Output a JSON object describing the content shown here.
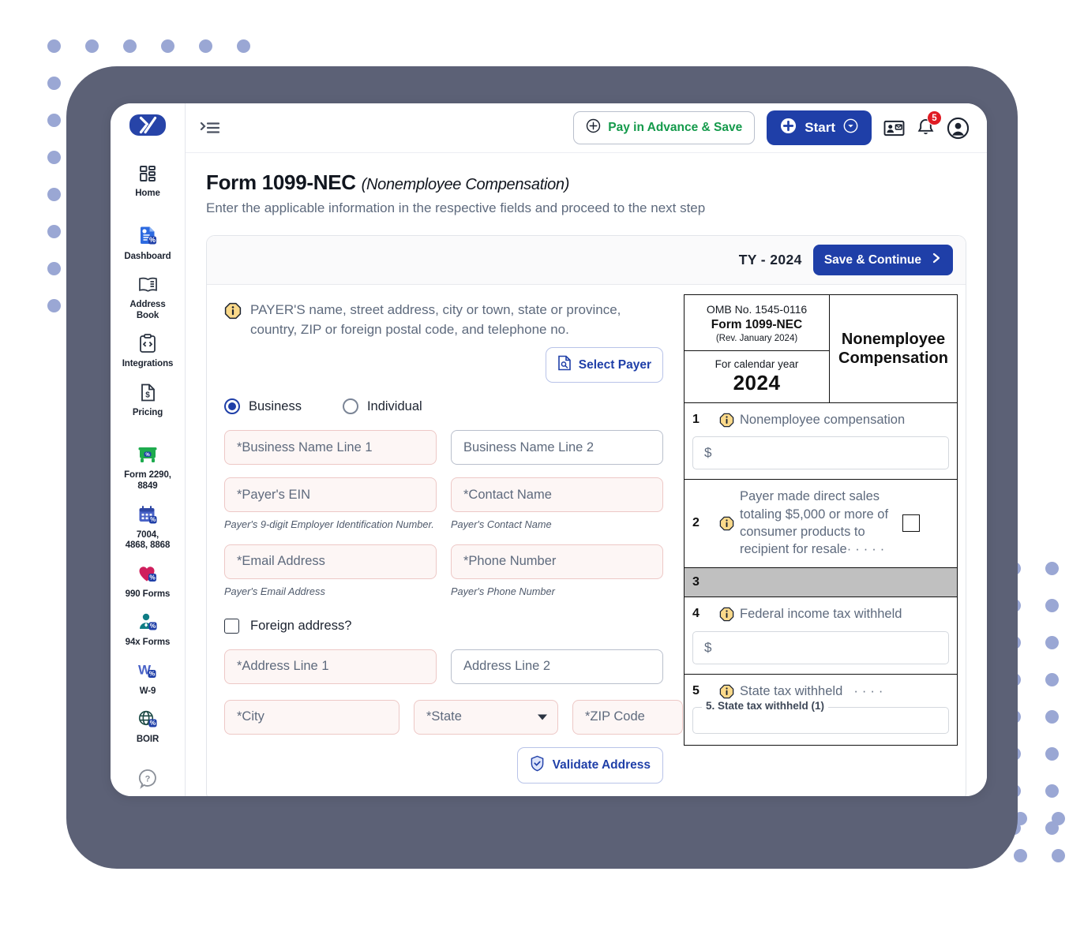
{
  "brand": {
    "logo_letter": "X",
    "accent": "#1f3fa8",
    "slab_color": "#5c6176",
    "dot_color": "#9aa7d4"
  },
  "sidebar": {
    "items": [
      {
        "label": "Home",
        "icon": "grid-icon"
      },
      {
        "label": "Dashboard",
        "icon": "dashboard-doc-icon"
      },
      {
        "label": "Address\nBook",
        "icon": "address-book-icon"
      },
      {
        "label": "Integrations",
        "icon": "integrations-code-icon"
      },
      {
        "label": "Pricing",
        "icon": "pricing-dollar-icon"
      },
      {
        "label": "Form 2290,\n8849",
        "icon": "truck-icon"
      },
      {
        "label": "7004,\n4868, 8868",
        "icon": "calendar-icon"
      },
      {
        "label": "990 Forms",
        "icon": "heart-icon"
      },
      {
        "label": "94x Forms",
        "icon": "person-tie-icon"
      },
      {
        "label": "W-9",
        "icon": "w9-icon"
      },
      {
        "label": "BOIR",
        "icon": "globe-icon"
      }
    ],
    "help_icon": "help-question-icon"
  },
  "topbar": {
    "menu_icon": "menu-collapse-icon",
    "pay_in_advance_label": "Pay in Advance & Save",
    "start_label": "Start",
    "contact_card_icon": "contact-card-icon",
    "bell_icon": "notification-bell-icon",
    "notification_count": "5",
    "avatar_icon": "user-avatar-icon"
  },
  "page": {
    "title": "Form 1099-NEC",
    "title_sub": "(Nonemployee Compensation)",
    "description": "Enter the applicable information in the respective fields and proceed to the next step"
  },
  "card_header": {
    "tax_year": "TY - 2024",
    "save_continue_label": "Save & Continue"
  },
  "payer": {
    "note_line1": "PAYER'S name, street address, city or town, state or province,",
    "note_line2": "country, ZIP or foreign postal code, and telephone no.",
    "select_payer_label": "Select Payer",
    "entity_options": [
      {
        "label": "Business",
        "selected": true
      },
      {
        "label": "Individual",
        "selected": false
      }
    ],
    "fields": {
      "business_name_1": {
        "placeholder": "*Business Name Line 1",
        "value": "",
        "required": true
      },
      "business_name_2": {
        "placeholder": "Business Name Line 2",
        "value": "",
        "required": false
      },
      "ein": {
        "placeholder": "*Payer's EIN",
        "value": "",
        "required": true,
        "hint": "Payer's 9-digit Employer Identification Number."
      },
      "contact_name": {
        "placeholder": "*Contact Name",
        "value": "",
        "required": true,
        "hint": "Payer's Contact Name"
      },
      "email": {
        "placeholder": "*Email Address",
        "value": "",
        "required": true,
        "hint": "Payer's Email Address"
      },
      "phone": {
        "placeholder": "*Phone Number",
        "value": "",
        "required": true,
        "hint": "Payer's Phone Number"
      },
      "foreign_address_label": "Foreign address?",
      "address_1": {
        "placeholder": "*Address Line 1",
        "value": "",
        "required": true
      },
      "address_2": {
        "placeholder": "Address Line 2",
        "value": "",
        "required": false
      },
      "city": {
        "placeholder": "*City",
        "value": "",
        "required": true
      },
      "state": {
        "placeholder": "*State",
        "value": "",
        "required": true
      },
      "zip": {
        "placeholder": "*ZIP Code",
        "value": "",
        "required": true
      }
    },
    "validate_label": "Validate Address"
  },
  "form_preview": {
    "omb": "OMB No. 1545-0116",
    "form_name": "Form 1099-NEC",
    "revision": "(Rev. January 2024)",
    "calendar_label": "For calendar year",
    "calendar_year": "2024",
    "title": "Nonemployee\nCompensation",
    "boxes": [
      {
        "no": "1",
        "label": "Nonemployee compensation",
        "money_symbol": "$",
        "type": "money"
      },
      {
        "no": "2",
        "label": "Payer made direct sales totaling $5,000 or more of consumer products to recipient for resale",
        "type": "checkbox"
      },
      {
        "no": "3",
        "label": "",
        "type": "grey"
      },
      {
        "no": "4",
        "label": "Federal income tax withheld",
        "money_symbol": "$",
        "type": "money"
      },
      {
        "no": "5",
        "label": "State tax withheld",
        "type": "fieldset",
        "legend": "5. State tax withheld (1)"
      }
    ]
  }
}
